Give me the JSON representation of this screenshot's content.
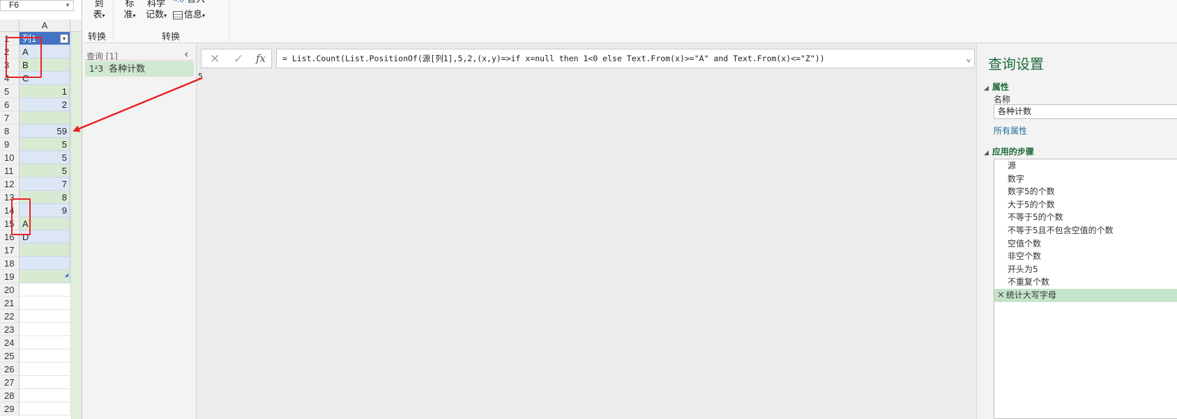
{
  "excel": {
    "name_box": "F6",
    "column_header": "A",
    "header_cell": "列1",
    "rows": [
      {
        "n": "1",
        "v": "列1",
        "kind": "header"
      },
      {
        "n": "2",
        "v": "A",
        "kind": "blue"
      },
      {
        "n": "3",
        "v": "B",
        "kind": "green"
      },
      {
        "n": "4",
        "v": "C",
        "kind": "blue"
      },
      {
        "n": "5",
        "v": "1",
        "kind": "green",
        "num": true
      },
      {
        "n": "6",
        "v": "2",
        "kind": "blue",
        "num": true
      },
      {
        "n": "7",
        "v": "",
        "kind": "green"
      },
      {
        "n": "8",
        "v": "59",
        "kind": "blue",
        "num": true
      },
      {
        "n": "9",
        "v": "5",
        "kind": "green",
        "num": true
      },
      {
        "n": "10",
        "v": "5",
        "kind": "blue",
        "num": true
      },
      {
        "n": "11",
        "v": "5",
        "kind": "green",
        "num": true
      },
      {
        "n": "12",
        "v": "7",
        "kind": "blue",
        "num": true
      },
      {
        "n": "13",
        "v": "8",
        "kind": "green",
        "num": true
      },
      {
        "n": "14",
        "v": "9",
        "kind": "blue",
        "num": true
      },
      {
        "n": "15",
        "v": "A",
        "kind": "green"
      },
      {
        "n": "16",
        "v": "D",
        "kind": "blue"
      },
      {
        "n": "17",
        "v": "",
        "kind": "green"
      },
      {
        "n": "18",
        "v": "",
        "kind": "blue"
      },
      {
        "n": "19",
        "v": "",
        "kind": "green"
      },
      {
        "n": "20",
        "v": "",
        "kind": "plain"
      },
      {
        "n": "21",
        "v": "",
        "kind": "plain"
      },
      {
        "n": "22",
        "v": "",
        "kind": "plain"
      },
      {
        "n": "23",
        "v": "",
        "kind": "plain"
      },
      {
        "n": "24",
        "v": "",
        "kind": "plain"
      },
      {
        "n": "25",
        "v": "",
        "kind": "plain"
      },
      {
        "n": "26",
        "v": "",
        "kind": "plain"
      },
      {
        "n": "27",
        "v": "",
        "kind": "plain"
      },
      {
        "n": "28",
        "v": "",
        "kind": "plain"
      },
      {
        "n": "29",
        "v": "",
        "kind": "plain"
      }
    ]
  },
  "ribbon": {
    "btn_to_table_line1": "到",
    "btn_to_table_line2": "表",
    "btn_standard_line1": "标",
    "btn_standard_line2": "准",
    "btn_scientific_line1": "科学",
    "btn_scientific_line2": "记数",
    "btn_rounding": "舍入",
    "btn_info": "信息",
    "group1_label": "转换",
    "group2_label": "转换"
  },
  "queries": {
    "title": "查询 [1]",
    "item_type": "1²3",
    "item_name": "各种计数"
  },
  "formula": {
    "cancel_icon": "✕",
    "commit_icon": "✓",
    "fx_label": "fx",
    "text": "= List.Count(List.PositionOf(源[列1],5,2,(x,y)=>if x=null then 1<0 else Text.From(x)>=\"A\" and Text.From(x)<=\"Z\"))",
    "result": "5"
  },
  "settings": {
    "title": "查询设置",
    "properties_section": "属性",
    "name_label": "名称",
    "name_value": "各种计数",
    "all_properties": "所有属性",
    "steps_section": "应用的步骤",
    "steps": [
      "源",
      "数字",
      "数字5的个数",
      "大于5的个数",
      "不等于5的个数",
      "不等于5且不包含空值的个数",
      "空值个数",
      "非空个数",
      "开头为5",
      "不重复个数",
      "统计大写字母"
    ],
    "active_step_index": 10
  },
  "colors": {
    "annotation_red": "#e82121",
    "accent_green": "#1e6b39",
    "table_header_blue": "#4472c4"
  }
}
